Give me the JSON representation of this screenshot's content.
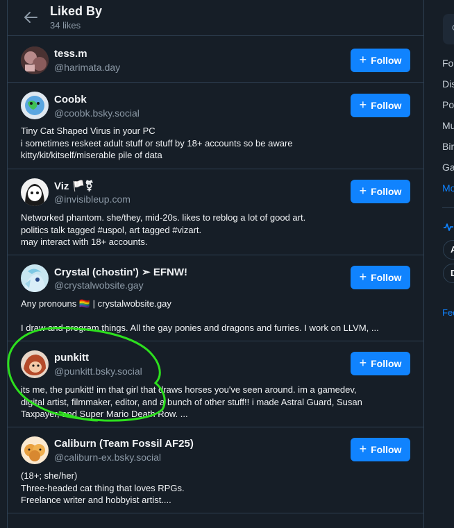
{
  "header": {
    "title": "Liked By",
    "subtitle": "34 likes"
  },
  "follow_label": "Follow",
  "users": [
    {
      "name": "tess.m",
      "handle": "@harimata.day",
      "bio": []
    },
    {
      "name": "Coobk",
      "handle": "@coobk.bsky.social",
      "bio": [
        "Tiny Cat Shaped Virus in your PC",
        "i sometimes reskeet adult stuff or stuff by 18+ accounts so be aware",
        "kitty/kit/kitself/miserable pile of data"
      ]
    },
    {
      "name": "Viz 🏳️⚧",
      "handle": "@invisibleup.com",
      "bio": [
        "Networked phantom. she/they, mid-20s. likes to reblog a lot of good art.",
        "politics talk tagged #uspol, art tagged #vizart.",
        "may interact with 18+ accounts."
      ]
    },
    {
      "name": "Crystal (chostin') ➣ EFNW!",
      "handle": "@crystalwobsite.gay",
      "bio": [
        "Any pronouns 🏳️‍🌈 | crystalwobsite.gay",
        "",
        "I draw and program things. All the gay ponies and dragons and furries. I work on LLVM, ..."
      ]
    },
    {
      "name": "punkitt",
      "handle": "@punkitt.bsky.social",
      "bio": [
        "its me, the punkitt! im that girl that draws horses you've seen around. im a gamedev,",
        "digital artist, filmmaker, editor, and a bunch of other stuff!! i made Astral Guard, Susan",
        "Taxpayer, and Super Mario Death Row. ..."
      ]
    },
    {
      "name": "Caliburn (Team Fossil AF25)",
      "handle": "@caliburn-ex.bsky.social",
      "bio": [
        "(18+; she/her)",
        "Three-headed cat thing that loves RPGs.",
        "Freelance writer and hobbyist artist...."
      ]
    }
  ],
  "right_panel": {
    "feeds": [
      "Fo",
      "Dis",
      "Po",
      "Mu",
      "Bir",
      "Ga"
    ],
    "more": "Mo",
    "pills": [
      "A",
      "D"
    ],
    "footer_link": "Fee"
  },
  "colors": {
    "accent": "#1083fe",
    "background": "#161e27",
    "border": "#2e4052",
    "annotation": "#2ddf1e"
  }
}
